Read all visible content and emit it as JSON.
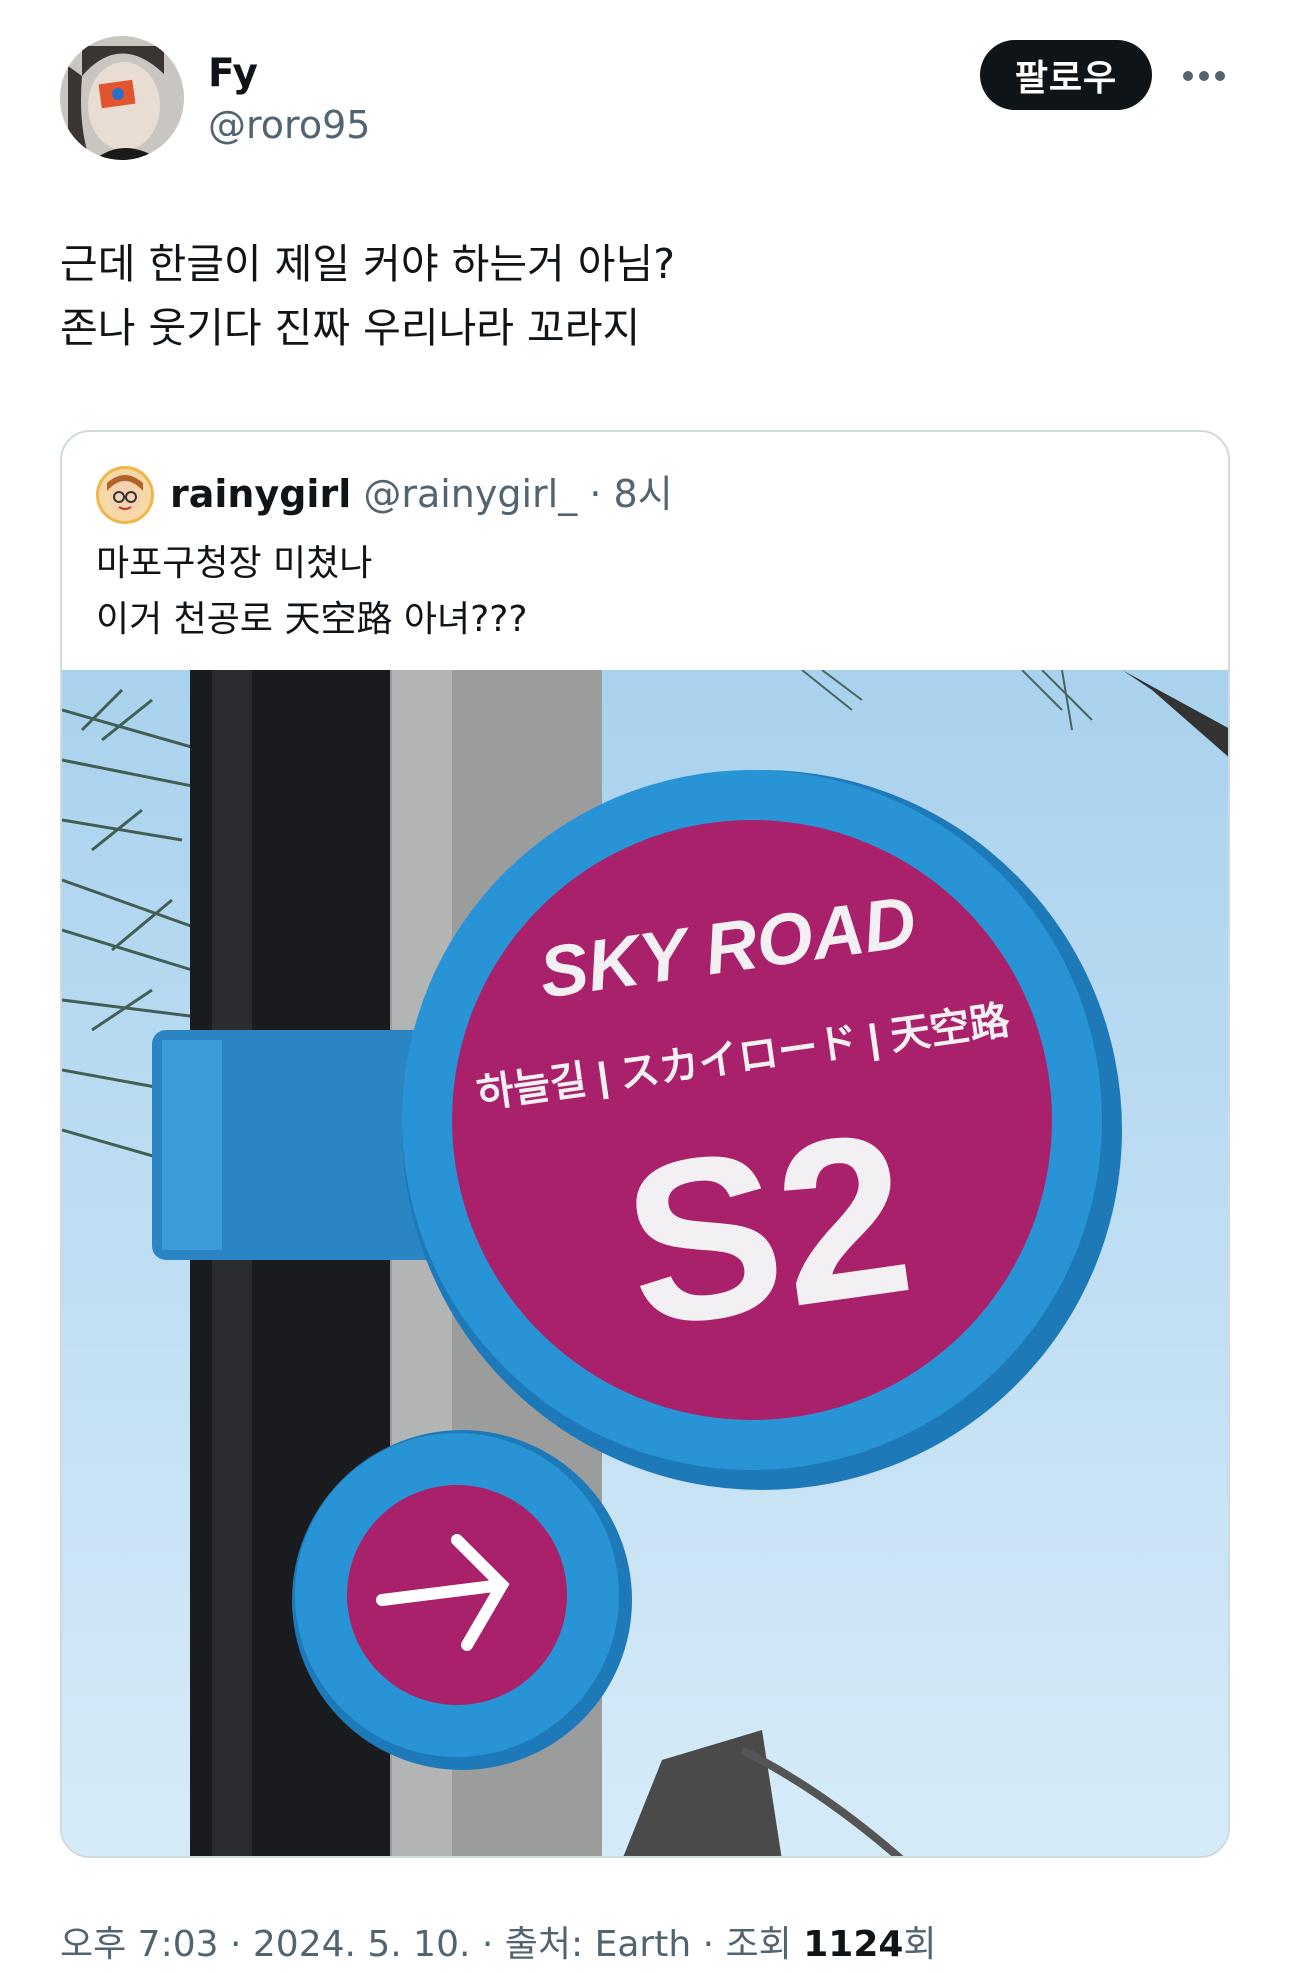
{
  "author": {
    "display_name": "Fy",
    "handle": "@roro95"
  },
  "actions": {
    "follow_label": "팔로우",
    "more_icon": "more-horizontal-icon"
  },
  "tweet": {
    "text": "근데 한글이 제일 커야 하는거 아님?\n존나 웃기다 진짜 우리나라 꼬라지"
  },
  "quoted": {
    "display_name": "rainygirl",
    "handle": "@rainygirl_",
    "separator": "·",
    "time": "8시",
    "text": "마포구청장 미쳤나\n이거 천공로 天空路 아녀???",
    "image": {
      "sign_title": "SKY ROAD",
      "sign_subtitle": "하늘길 | スカイロード | 天空路",
      "sign_code": "S2",
      "arrow_icon": "arrow-right-icon"
    }
  },
  "footer": {
    "time": "오후 7:03",
    "sep1": "·",
    "date": "2024. 5. 10.",
    "sep2": "·",
    "source": "출처: Earth",
    "sep3": "·",
    "views_label": "조회",
    "views_count": "1124",
    "views_suffix": "회"
  },
  "colors": {
    "follow_bg": "#0f1419",
    "secondary_text": "#536471",
    "sign_blue": "#1f8fd6",
    "sign_magenta": "#b0246b",
    "sky": "#bcdcf2"
  }
}
